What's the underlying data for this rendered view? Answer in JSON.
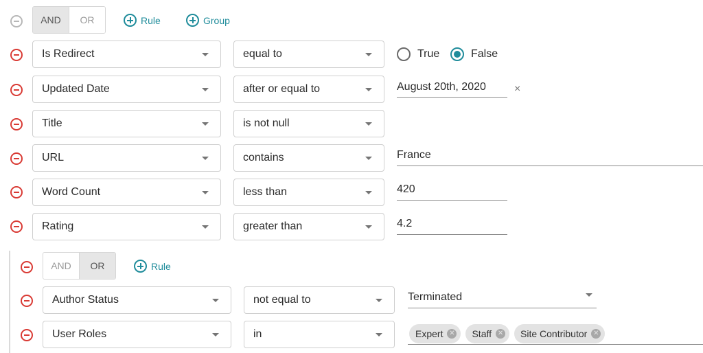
{
  "root": {
    "conjunctions": [
      "AND",
      "OR"
    ],
    "active_conjunction": "AND",
    "add_rule_label": "Rule",
    "add_group_label": "Group"
  },
  "rules": [
    {
      "field": "Is Redirect",
      "operator": "equal to",
      "options": [
        "True",
        "False"
      ],
      "selected": "False"
    },
    {
      "field": "Updated Date",
      "operator": "after or equal to",
      "value": "August 20th, 2020",
      "clear_icon": "×"
    },
    {
      "field": "Title",
      "operator": "is not null"
    },
    {
      "field": "URL",
      "operator": "contains",
      "value": "France"
    },
    {
      "field": "Word Count",
      "operator": "less than",
      "value": "420"
    },
    {
      "field": "Rating",
      "operator": "greater than",
      "value": "4.2"
    }
  ],
  "group": {
    "conjunctions": [
      "AND",
      "OR"
    ],
    "active_conjunction": "OR",
    "add_rule_label": "Rule",
    "rules": [
      {
        "field": "Author Status",
        "operator": "not equal to",
        "value": "Terminated"
      },
      {
        "field": "User Roles",
        "operator": "in",
        "chips": [
          "Expert",
          "Staff",
          "Site Contributor"
        ]
      }
    ]
  },
  "colors": {
    "remove": "#d93a34",
    "accent": "#1f8c9b",
    "disabled": "#b7b7b7"
  },
  "icons": {
    "remove": "minus-circle-icon",
    "add": "plus-circle-icon",
    "dropdown": "caret-down-icon",
    "chip_remove": "close-circle-icon",
    "chip_remove_glyph": "✕"
  }
}
